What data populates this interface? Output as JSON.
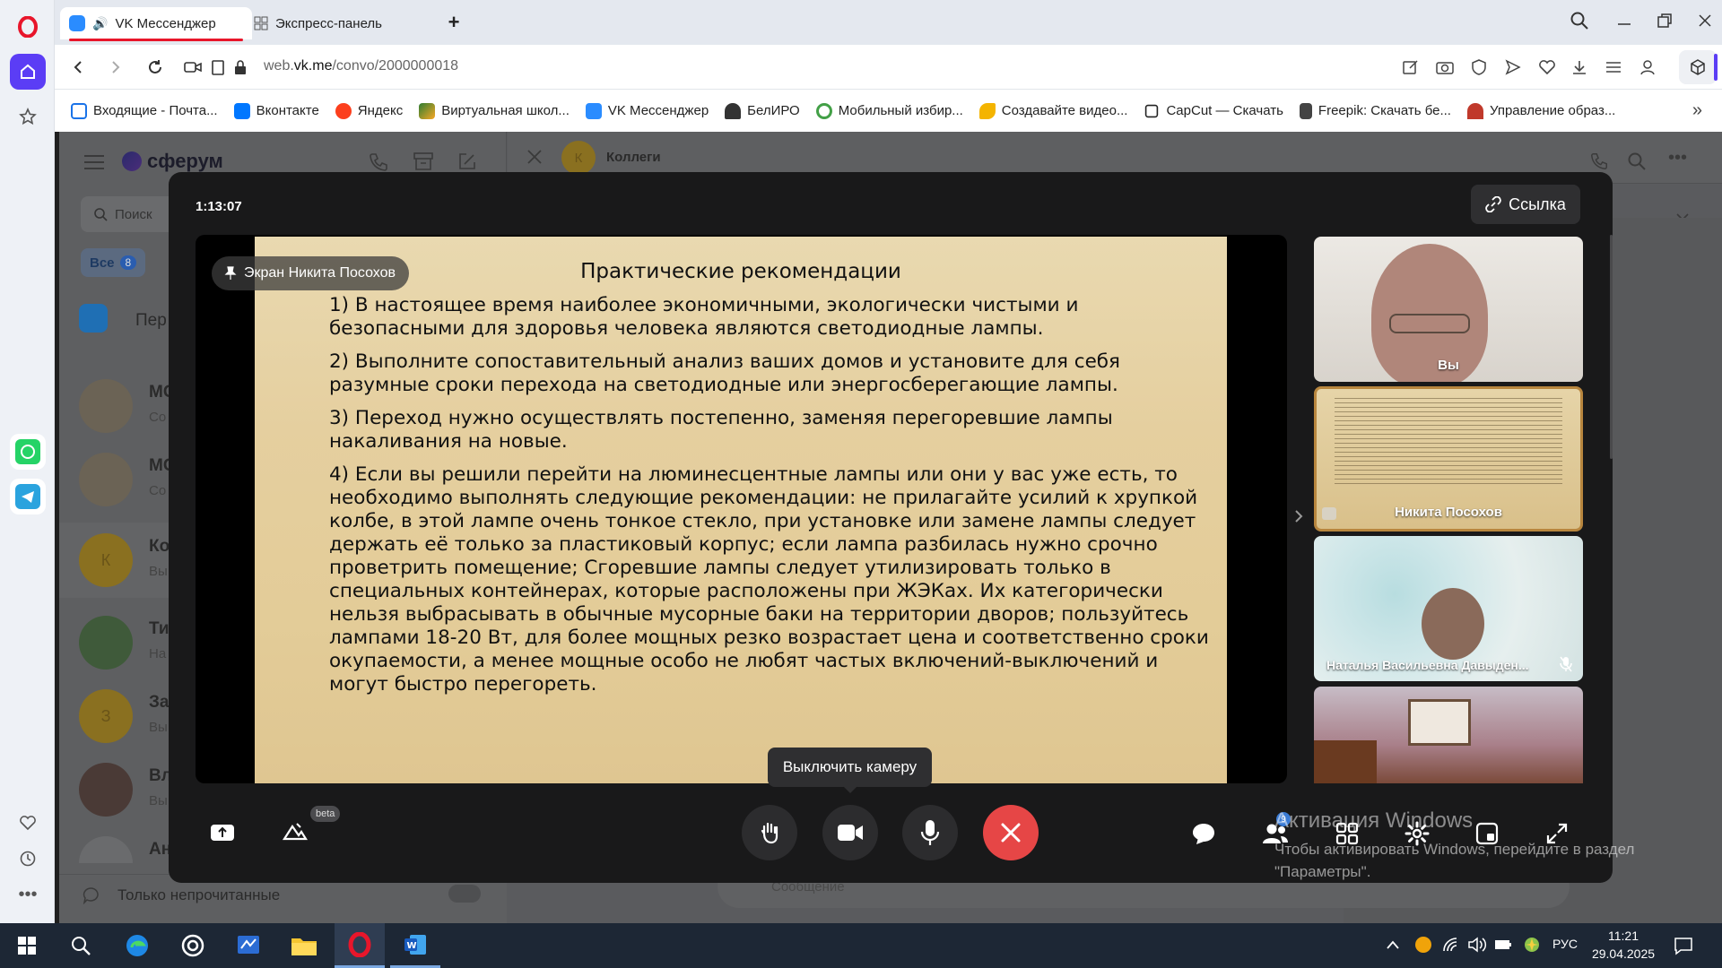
{
  "browser": {
    "tabs": [
      {
        "label": "VK Мессенджер",
        "active": true
      },
      {
        "label": "Экспресс-панель",
        "active": false
      }
    ],
    "address": {
      "host_prefix": "web.",
      "host_main": "vk.me",
      "path": "/convo/2000000018"
    },
    "bookmarks": [
      {
        "label": "Входящие - Почта...",
        "color": "#1a73e8"
      },
      {
        "label": "Вконтакте",
        "color": "#0077ff"
      },
      {
        "label": "Яндекс",
        "color": "#fc3f1d"
      },
      {
        "label": "Виртуальная школ...",
        "color": "#2e7d32"
      },
      {
        "label": "VK Мессенджер",
        "color": "#2a8cff"
      },
      {
        "label": "БелИРО",
        "color": "#333333"
      },
      {
        "label": "Мобильный избир...",
        "color": "#43a047"
      },
      {
        "label": "Создавайте видео...",
        "color": "#f4b400"
      },
      {
        "label": "CapCut — Скачать",
        "color": "#222222"
      },
      {
        "label": "Freepik: Скачать бе...",
        "color": "#444444"
      },
      {
        "label": "Управление образ...",
        "color": "#c0392b"
      }
    ]
  },
  "vk_background": {
    "brand": "сферум",
    "search_placeholder": "Поиск",
    "filter_all": "Все",
    "filter_count": "8",
    "chat_title": "Коллеги",
    "chat_avatar_letter": "К",
    "list": [
      {
        "title": "Пер",
        "sub": ""
      },
      {
        "title": "МС",
        "sub": "Со"
      },
      {
        "title": "МС",
        "sub": "Со"
      },
      {
        "title": "Ко",
        "sub": "Вы",
        "letter": "К"
      },
      {
        "title": "Ти",
        "sub": "На"
      },
      {
        "title": "За",
        "sub": "Вы",
        "letter": "З"
      },
      {
        "title": "Вл",
        "sub": "Вы"
      },
      {
        "title": "Ан",
        "sub": ""
      }
    ],
    "only_unread": "Только непрочитанные",
    "message_placeholder": "Сообщение"
  },
  "call": {
    "timer": "1:13:07",
    "link_button": "Ссылка",
    "screen_badge": "Экран Никита Посохов",
    "slide": {
      "title": "Практические рекомендации",
      "paragraphs": [
        "1) В настоящее время наиболее экономичными, экологически чистыми и безопасными для здоровья человека являются светодиодные лампы.",
        "2) Выполните сопоставительный анализ ваших домов и установите для себя разумные сроки перехода на светодиодные или энергосберегающие лампы.",
        "3) Переход нужно осуществлять постепенно, заменяя перегоревшие лампы накаливания на новые.",
        "4) Если вы решили перейти на люминесцентные лампы или они у вас уже есть, то необходимо выполнять следующие рекомендации: не прилагайте усилий к хрупкой колбе, в этой лампе  очень тонкое стекло, при установке или замене лампы следует держать её только за пластиковый корпус; если лампа разбилась нужно срочно проветрить помещение; Сгоревшие лампы следует утилизировать только в специальных контейнерах, которые расположены при ЖЭКах. Их категорически нельзя выбрасывать в обычные мусорные баки на территории дворов; пользуйтесь лампами 18-20 Вт, для более мощных резко возрастает цена и соответственно сроки окупаемости, а менее мощные особо не любят частых включений-выключений и могут быстро перегореть."
      ]
    },
    "participants": [
      {
        "name": "Вы"
      },
      {
        "name": "Никита Посохов"
      },
      {
        "name": "Наталья Васильевна Давыден..."
      },
      {
        "name": ""
      }
    ],
    "beta_label": "beta",
    "participants_count": "9",
    "tooltip": "Выключить камеру"
  },
  "watermark": {
    "title": "Активация Windows",
    "line1": "Чтобы активировать Windows, перейдите в раздел",
    "line2": "\"Параметры\"."
  },
  "taskbar": {
    "lang": "РУС",
    "time": "11:21",
    "date": "29.04.2025"
  }
}
